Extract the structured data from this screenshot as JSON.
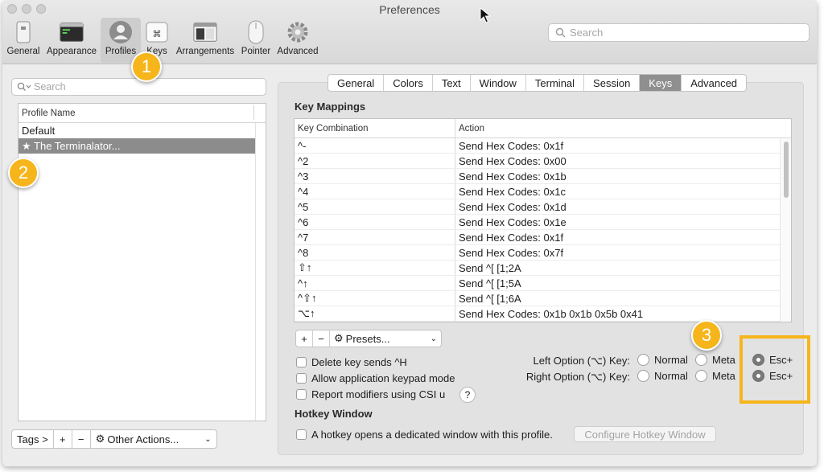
{
  "window": {
    "title": "Preferences"
  },
  "toolbar": {
    "items": [
      {
        "label": "General",
        "icon": "general-icon"
      },
      {
        "label": "Appearance",
        "icon": "appearance-icon"
      },
      {
        "label": "Profiles",
        "icon": "profiles-icon",
        "active": true
      },
      {
        "label": "Keys",
        "icon": "keys-icon"
      },
      {
        "label": "Arrangements",
        "icon": "arrangements-icon"
      },
      {
        "label": "Pointer",
        "icon": "pointer-icon"
      },
      {
        "label": "Advanced",
        "icon": "gear-icon"
      }
    ],
    "search_placeholder": "Search"
  },
  "profiles": {
    "search_placeholder": "Search",
    "column_header": "Profile Name",
    "items": [
      "Default",
      "★ The Terminalator..."
    ],
    "selected_index": 1,
    "bottom": {
      "tags": "Tags >",
      "add": "+",
      "remove": "−",
      "other_actions": "Other Actions..."
    }
  },
  "tabs": [
    "General",
    "Colors",
    "Text",
    "Window",
    "Terminal",
    "Session",
    "Keys",
    "Advanced"
  ],
  "active_tab": "Keys",
  "key_mappings": {
    "title": "Key Mappings",
    "headers": [
      "Key Combination",
      "Action"
    ],
    "rows": [
      [
        "^-",
        "Send Hex Codes: 0x1f"
      ],
      [
        "^2",
        "Send Hex Codes: 0x00"
      ],
      [
        "^3",
        "Send Hex Codes: 0x1b"
      ],
      [
        "^4",
        "Send Hex Codes: 0x1c"
      ],
      [
        "^5",
        "Send Hex Codes: 0x1d"
      ],
      [
        "^6",
        "Send Hex Codes: 0x1e"
      ],
      [
        "^7",
        "Send Hex Codes: 0x1f"
      ],
      [
        "^8",
        "Send Hex Codes: 0x7f"
      ],
      [
        "⇧↑",
        "Send ^[ [1;2A"
      ],
      [
        "^↑",
        "Send ^[ [1;5A"
      ],
      [
        "^⇧↑",
        "Send ^[ [1;6A"
      ],
      [
        "⌥↑",
        "Send Hex Codes: 0x1b 0x1b 0x5b 0x41"
      ]
    ],
    "tools": {
      "add": "+",
      "remove": "−",
      "presets": "Presets..."
    }
  },
  "checkboxes": [
    {
      "label": "Delete key sends ^H",
      "checked": false
    },
    {
      "label": "Allow application keypad mode",
      "checked": false
    },
    {
      "label": "Report modifiers using CSI u",
      "checked": false
    }
  ],
  "help": "?",
  "option_keys": {
    "left_label": "Left Option (⌥) Key:",
    "right_label": "Right Option (⌥) Key:",
    "choices": [
      "Normal",
      "Meta",
      "Esc+"
    ],
    "left_selected": "Esc+",
    "right_selected": "Esc+"
  },
  "hotkey": {
    "title": "Hotkey Window",
    "checkbox_label": "A hotkey opens a dedicated window with this profile.",
    "button": "Configure Hotkey Window"
  },
  "callouts": [
    "1",
    "2",
    "3"
  ],
  "colors": {
    "accent": "#f5b51b",
    "selection": "#8c8c8c"
  }
}
